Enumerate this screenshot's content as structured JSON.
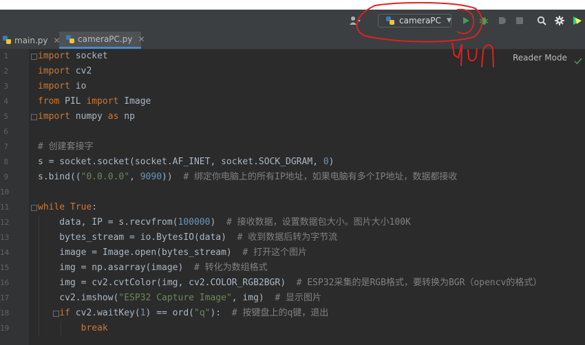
{
  "toolbar": {
    "run_config_label": "cameraPC",
    "icons": [
      "user-icon",
      "python-icon",
      "dropdown-icon",
      "run-icon",
      "debug-icon",
      "coverage-icon",
      "stop-icon",
      "search-icon",
      "gear-icon",
      "pycharm-icon"
    ]
  },
  "tabs": [
    {
      "label": "main.py"
    },
    {
      "label": "cameraPC.py"
    }
  ],
  "editor": {
    "reader_mode": "Reader Mode",
    "line_numbers": [
      "1",
      "2",
      "3",
      "4",
      "5",
      "6",
      "7",
      "8",
      "9",
      "10",
      "11",
      "12",
      "13",
      "14",
      "15",
      "16",
      "17",
      "18",
      "19"
    ]
  },
  "annotation": {
    "handwritten_text": "YUN",
    "color": "#e02020"
  },
  "colors": {
    "keyword": "#cc7832",
    "string": "#6a8759",
    "number": "#6897bb",
    "comment": "#808080",
    "text": "#a9b7c6",
    "run_green": "#499c54"
  },
  "code": {
    "l1": {
      "kw": "import",
      "rest": " socket"
    },
    "l2": {
      "kw": "import",
      "rest": " cv2"
    },
    "l3": {
      "kw": "import",
      "rest": " io"
    },
    "l4": {
      "kw1": "from",
      "mid": " PIL ",
      "kw2": "import",
      "rest": " Image"
    },
    "l5": {
      "kw1": "import",
      "mid": " numpy ",
      "kw2": "as",
      "rest": " np"
    },
    "l7": {
      "comment": "# 创建套接字"
    },
    "l8": {
      "a": "s = socket.socket(socket.AF_INET, socket.SOCK_DGRAM, ",
      "num": "0",
      "b": ")"
    },
    "l9": {
      "a": "s.bind((",
      "str1": "\"0.0.0.0\"",
      "b": ", ",
      "num": "9090",
      "c": "))  ",
      "comment": "# 绑定你电脑上的所有IP地址，如果电脑有多个IP地址，数据都接收"
    },
    "l11": {
      "kw1": "while",
      "sp": " ",
      "kw2": "True",
      "b": ":"
    },
    "l12": {
      "a": "    data, IP = s.recvfrom(",
      "num": "100000",
      "b": ")  ",
      "comment": "# 接收数据，设置数据包大小。图片大小100K"
    },
    "l13": {
      "a": "    bytes_stream = io.BytesIO(data)  ",
      "comment": "# 收到数据后转为字节流"
    },
    "l14": {
      "a": "    image = Image.open(bytes_stream)  ",
      "comment": "# 打开这个图片"
    },
    "l15": {
      "a": "    img = np.asarray(image)  ",
      "comment": "# 转化为数组格式"
    },
    "l16": {
      "a": "    img = cv2.cvtColor(img, cv2.COLOR_RGB2BGR)  ",
      "comment": "# ESP32采集的是RGB格式，要转换为BGR（opencv的格式）"
    },
    "l17": {
      "a": "    cv2.imshow(",
      "str1": "\"ESP32 Capture Image\"",
      "b": ", img)  ",
      "comment": "# 显示图片"
    },
    "l18": {
      "ind": "    ",
      "kw": "if",
      "a": " cv2.waitKey(",
      "num": "1",
      "b": ") == ord(",
      "str1": "\"q\"",
      "c": "):  ",
      "comment": "# 按键盘上的q键，退出"
    },
    "l19": {
      "ind": "        ",
      "kw": "break"
    }
  }
}
